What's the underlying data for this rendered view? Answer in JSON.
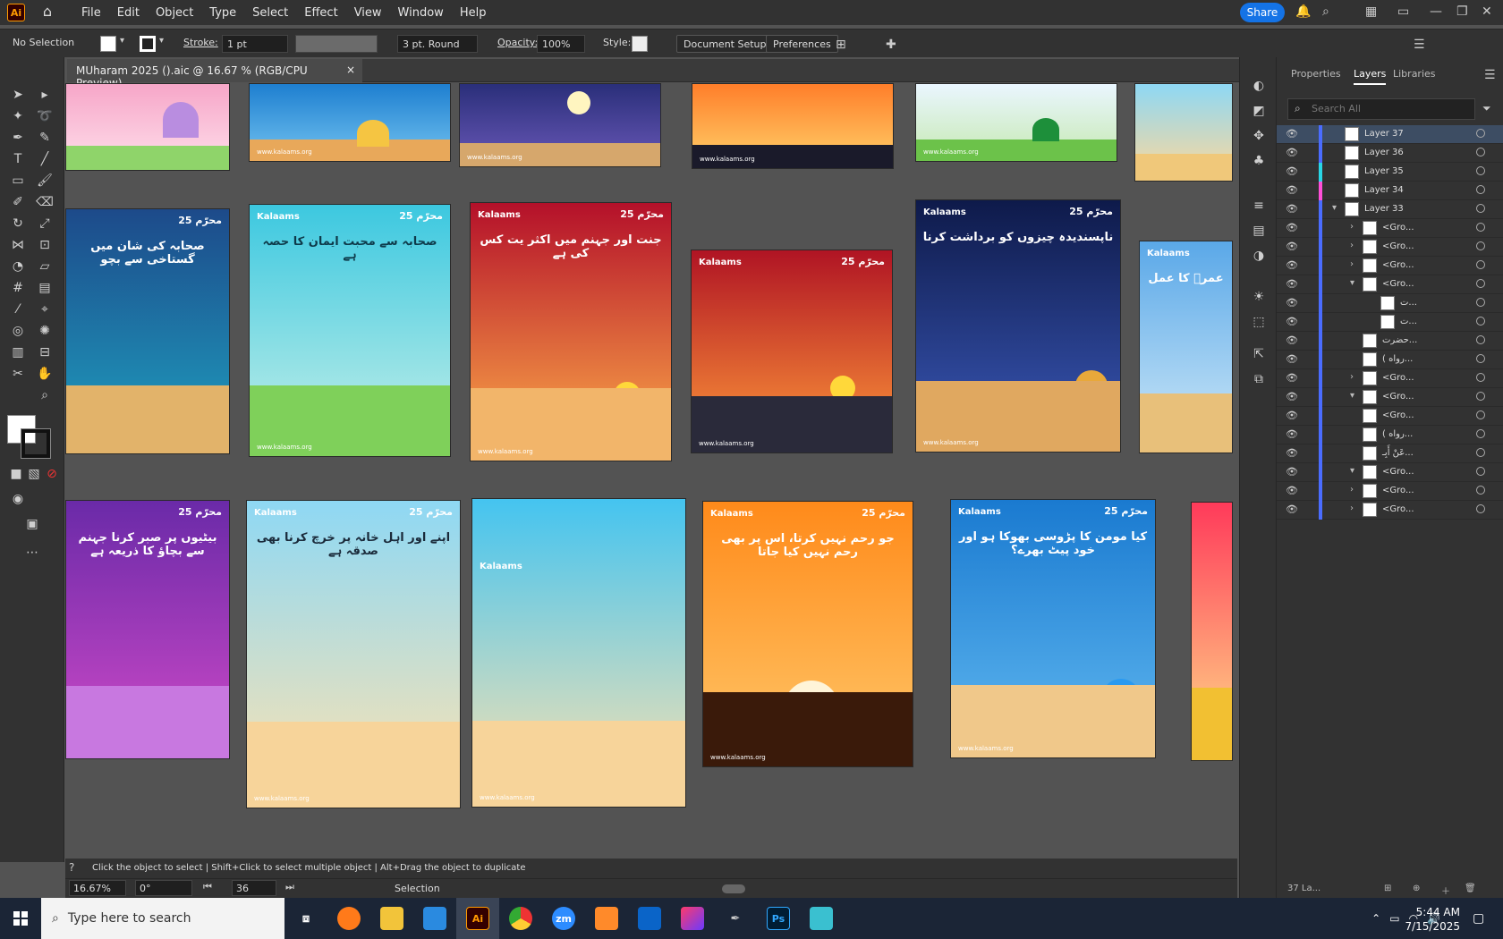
{
  "app": {
    "logo": "Ai"
  },
  "menu": [
    "File",
    "Edit",
    "Object",
    "Type",
    "Select",
    "Effect",
    "View",
    "Window",
    "Help"
  ],
  "header": {
    "share_label": "Share"
  },
  "control": {
    "selection": "No Selection",
    "stroke_label": "Stroke:",
    "stroke_value": "1 pt",
    "brush_value": "3 pt. Round",
    "opacity_label": "Opacity:",
    "opacity_value": "100%",
    "style_label": "Style:",
    "doc_setup": "Document Setup",
    "preferences": "Preferences"
  },
  "document": {
    "tab_title": "MUharam 2025 ().aic @ 16.67 % (RGB/CPU Preview)",
    "close": "×"
  },
  "artboards": {
    "logo": "Kalaams",
    "badge": "محرّم 25",
    "url": "www.kalaams.org",
    "t1": "صحابہ کی شان میں گستاخی سے بچو",
    "t2": "صحابہ سے محبت ایمان کا حصہ ہے",
    "t3": "جنت اور جہنم میں اکثر یت کس کی ہے",
    "t4": "ناپسندیدہ چیزوں کو برداشت کرنا",
    "t5": "عمرؓ کا عمل",
    "t6": "بیٹیوں پر صبر کرنا جہنم سے بچاؤ کا ذریعہ ہے",
    "t7": "اپنے اور اہل خانہ پر خرچ کرنا بھی صدقہ ہے",
    "t8": "جو رحم نہیں کرتا، اس پر بھی رحم نہیں کیا جاتا",
    "t9": "کیا مومن کا پڑوسی بھوکا ہو اور خود پیٹ بھرے؟"
  },
  "status": {
    "hint": "Click the object to select  |  Shift+Click to select multiple object  |  Alt+Drag the object to duplicate",
    "zoom": "16.67%",
    "rotation": "0°",
    "artboard_num": "36",
    "tool": "Selection"
  },
  "panel": {
    "tabs": [
      "Properties",
      "Layers",
      "Libraries"
    ],
    "search_placeholder": "Search All",
    "footer": "37 La...",
    "layers": [
      {
        "name": "Layer 37",
        "color": "#4a6cff"
      },
      {
        "name": "Layer 36",
        "color": "#4a6cff"
      },
      {
        "name": "Layer 35",
        "color": "#29d6e6"
      },
      {
        "name": "Layer 34",
        "color": "#ff4fd8"
      },
      {
        "name": "Layer 33",
        "color": "#4a6cff"
      },
      {
        "name": "<Gro...",
        "color": "#4a6cff"
      },
      {
        "name": "<Gro...",
        "color": "#4a6cff"
      },
      {
        "name": "<Gro...",
        "color": "#4a6cff"
      },
      {
        "name": "<Gro...",
        "color": "#4a6cff"
      },
      {
        "name": "ت...",
        "color": "#4a6cff"
      },
      {
        "name": "ت...",
        "color": "#4a6cff"
      },
      {
        "name": "حضرت...",
        "color": "#4a6cff"
      },
      {
        "name": "( رواه...",
        "color": "#4a6cff"
      },
      {
        "name": "<Gro...",
        "color": "#4a6cff"
      },
      {
        "name": "<Gro...",
        "color": "#4a6cff"
      },
      {
        "name": "<Gro...",
        "color": "#4a6cff"
      },
      {
        "name": "( رواه...",
        "color": "#4a6cff"
      },
      {
        "name": "عَنْ أَبِـ...",
        "color": "#4a6cff"
      },
      {
        "name": "<Gro...",
        "color": "#4a6cff"
      },
      {
        "name": "<Gro...",
        "color": "#4a6cff"
      },
      {
        "name": "<Gro...",
        "color": "#4a6cff"
      }
    ]
  },
  "taskbar": {
    "search_placeholder": "Type here to search",
    "time": "5:44 AM",
    "date": "7/15/2025",
    "apps": [
      "Ai",
      "Ps",
      "zm"
    ]
  }
}
